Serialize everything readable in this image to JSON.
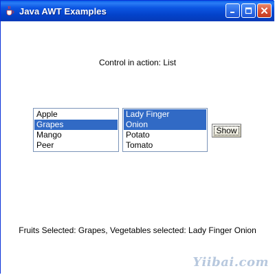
{
  "window": {
    "title": "Java AWT Examples",
    "icon": "java-cup-icon",
    "controls": {
      "minimize": "minimize-icon",
      "maximize": "maximize-icon",
      "close": "close-icon"
    }
  },
  "header_label": "Control in action: List",
  "fruits_list": {
    "items": [
      {
        "label": "Apple",
        "selected": false
      },
      {
        "label": "Grapes",
        "selected": true
      },
      {
        "label": "Mango",
        "selected": false
      },
      {
        "label": "Peer",
        "selected": false
      }
    ]
  },
  "vegetables_list": {
    "items": [
      {
        "label": "Lady Finger",
        "selected": true
      },
      {
        "label": "Onion",
        "selected": true
      },
      {
        "label": "Potato",
        "selected": false
      },
      {
        "label": "Tomato",
        "selected": false
      }
    ]
  },
  "show_button": {
    "label": "Show"
  },
  "status_label": "Fruits Selected: Grapes, Vegetables selected: Lady Finger Onion",
  "watermark": "Yiibai.com",
  "colors": {
    "titlebar": "#0c55e2",
    "selection": "#316ac5",
    "close_button": "#d9553b"
  }
}
